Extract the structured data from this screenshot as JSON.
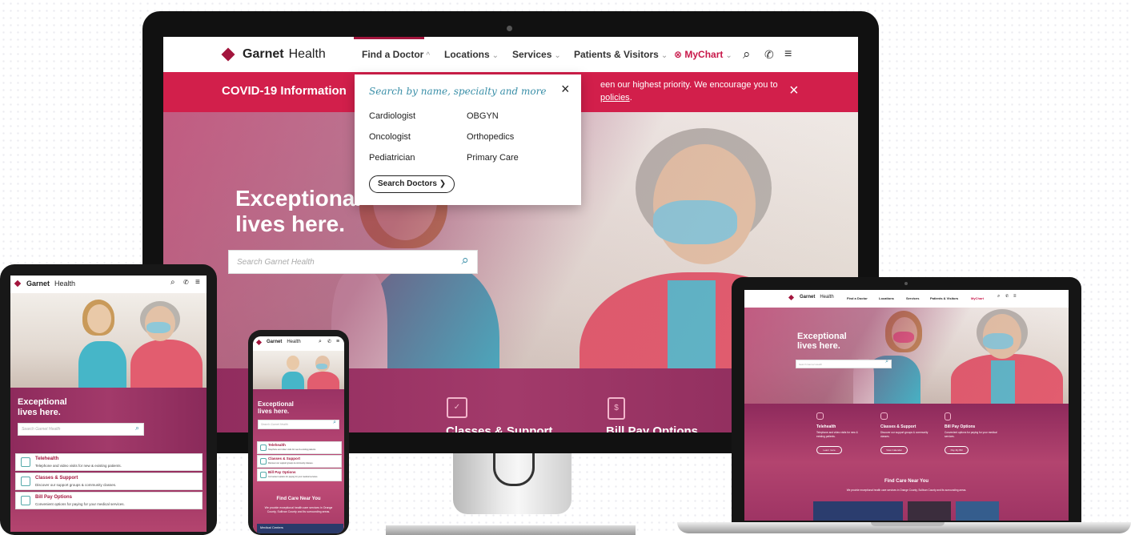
{
  "monitor": {
    "logo": {
      "brand_bold": "Garnet",
      "brand_light": "Health"
    },
    "nav": [
      {
        "label": "Find a Doctor",
        "chev": "^"
      },
      {
        "label": "Locations",
        "chev": "⌄"
      },
      {
        "label": "Services",
        "chev": "⌄"
      },
      {
        "label": "Patients & Visitors",
        "chev": "⌄"
      },
      {
        "label": "MyChart",
        "chev": "⌄"
      }
    ],
    "covid": {
      "title": "COVID-19 Information",
      "msg_line1": "een our highest priority. We encourage you to",
      "msg_link": "policies",
      "msg_end": ".",
      "close": "×"
    },
    "dropdown": {
      "heading": "Search by name, specialty and more",
      "close": "×",
      "items": [
        "Cardiologist",
        "OBGYN",
        "Oncologist",
        "Orthopedics",
        "Pediatrician",
        "Primary Care"
      ],
      "button": "Search Doctors"
    },
    "hero": {
      "title_line1": "Exceptional",
      "title_line2": "lives here.",
      "search_placeholder": "Search Garnet Health"
    },
    "features": [
      "Classes & Support",
      "Bill Pay Options"
    ]
  },
  "tablet": {
    "logo": {
      "brand_bold": "Garnet",
      "brand_light": "Health"
    },
    "hero": {
      "title_line1": "Exceptional",
      "title_line2": "lives here.",
      "search_placeholder": "Search Garnet Health"
    },
    "cards": [
      {
        "title": "Telehealth",
        "desc": "Telephone and video visits for new & existing patients."
      },
      {
        "title": "Classes & Support",
        "desc": "Discover our support groups & community classes."
      },
      {
        "title": "Bill Pay Options",
        "desc": "Convenient options for paying for your medical services."
      }
    ]
  },
  "phone": {
    "logo": {
      "brand_bold": "Garnet",
      "brand_light": "Health"
    },
    "hero": {
      "title_line1": "Exceptional",
      "title_line2": "lives here.",
      "search_placeholder": "Search Garnet Health"
    },
    "cards": [
      {
        "title": "Telehealth",
        "desc": "Telephone and video visits for new & existing patients."
      },
      {
        "title": "Classes & Support",
        "desc": "Discover our support groups & community classes."
      },
      {
        "title": "Bill Pay Options",
        "desc": "Convenient options for paying for your medical services."
      }
    ],
    "find_care": {
      "title": "Find Care Near You",
      "desc": "We provide exceptional health care services in Orange County, Sullivan County and its surrounding areas.",
      "tab": "Medical Centers"
    }
  },
  "laptop": {
    "logo": {
      "brand_bold": "Garnet",
      "brand_light": "Health"
    },
    "nav": [
      "Find a Doctor",
      "Locations",
      "Services",
      "Patients & Visitors",
      "MyChart"
    ],
    "hero": {
      "title_line1": "Exceptional",
      "title_line2": "lives here.",
      "search_placeholder": "Search Garnet Health"
    },
    "features": [
      {
        "title": "Telehealth",
        "desc": "Telephone and video visits for new & existing patients.",
        "btn": "Learn more"
      },
      {
        "title": "Classes & Support",
        "desc": "Discover our support groups & community classes.",
        "btn": "View Calendar"
      },
      {
        "title": "Bill Pay Options",
        "desc": "Convenient options for paying for your medical services.",
        "btn": "Pay My Bill"
      }
    ],
    "find_care": {
      "title": "Find Care Near You",
      "desc": "We provide exceptional health care services in Orange County, Sullivan County and its surrounding areas."
    }
  },
  "colors": {
    "brand": "#a3153d",
    "covid_banner": "#d21f4b",
    "accent_teal": "#3a8fa8"
  }
}
